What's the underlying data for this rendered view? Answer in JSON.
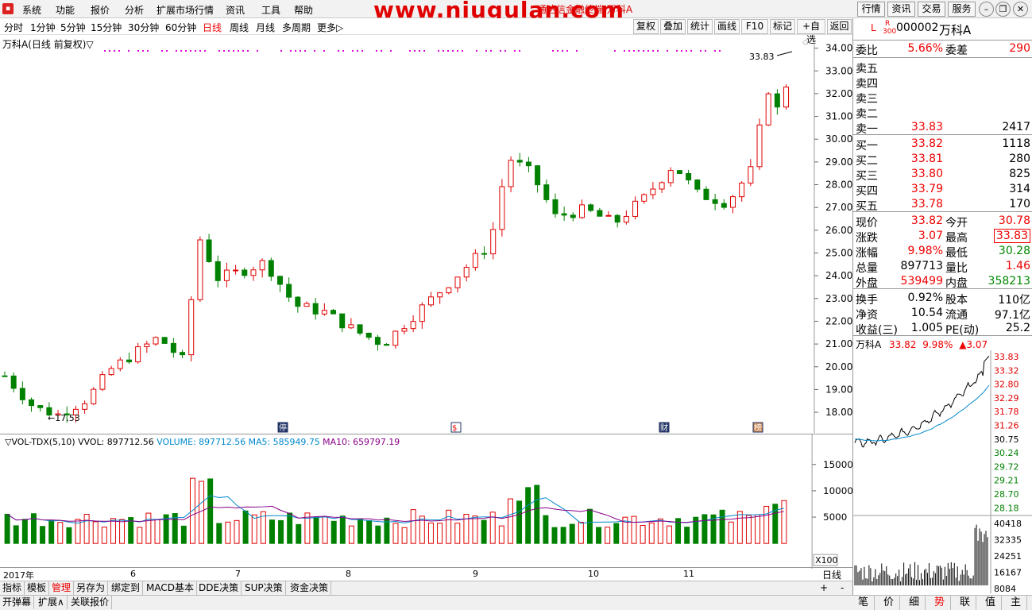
{
  "watermark": "www.niugulan.com",
  "app_title": "通达信金融终端 万科A",
  "menu": [
    "系统",
    "功能",
    "报价",
    "分析",
    "扩展市场行情",
    "资讯",
    "工具",
    "帮助"
  ],
  "top_buttons": [
    "行情",
    "资讯",
    "交易",
    "服务"
  ],
  "periods": [
    "分时",
    "1分钟",
    "5分钟",
    "15分钟",
    "30分钟",
    "60分钟",
    "日线",
    "周线",
    "月线",
    "多周期",
    "更多▷"
  ],
  "active_period": "日线",
  "toolbar_right": [
    "复权",
    "叠加",
    "统计",
    "画线",
    "F10",
    "标记",
    "+自选",
    "返回"
  ],
  "stock_label": "万科A(日线 前复权)▽",
  "price_axis": [
    "34.00",
    "33.00",
    "32.00",
    "31.00",
    "30.00",
    "29.00",
    "28.00",
    "27.00",
    "26.00",
    "25.00",
    "24.00",
    "23.00",
    "22.00",
    "21.00",
    "20.00",
    "19.00",
    "18.00"
  ],
  "high_marker": "33.83",
  "low_marker": "←17.53",
  "event_markers": [
    "停",
    "$",
    "财",
    "榜"
  ],
  "vol_indicator": {
    "name": "▽VOL-TDX(5,10)",
    "vvol": "VVOL: 897712.56",
    "volume": "VOLUME: 897712.56",
    "ma5": "MA5: 585949.75",
    "ma10": "MA10: 659797.19"
  },
  "vol_axis": [
    "15000",
    "10000",
    "5000"
  ],
  "vol_unit": "X100",
  "time_axis": [
    "2017年",
    "6",
    "7",
    "8",
    "9",
    "10",
    "11"
  ],
  "time_axis_right": "日线",
  "bottom_tabs1": [
    "指标",
    "模板",
    "管理",
    "另存为",
    "绑定到",
    "MACD基本",
    "DDE决策",
    "SUP决策",
    "资金决策"
  ],
  "bottom_tabs1_active": "管理",
  "bottom_tabs2": [
    "开弹幕",
    "扩展∧",
    "关联报价"
  ],
  "quote": {
    "code": "000002",
    "name": "万科A",
    "badge_l": "L",
    "badge_r": "R",
    "badge_300": "300",
    "weibi_label": "委比",
    "weibi": "5.66%",
    "weicha_label": "委差",
    "weicha": "290",
    "asks": [
      {
        "label": "卖五",
        "price": "",
        "vol": ""
      },
      {
        "label": "卖四",
        "price": "",
        "vol": ""
      },
      {
        "label": "卖三",
        "price": "",
        "vol": ""
      },
      {
        "label": "卖二",
        "price": "",
        "vol": ""
      },
      {
        "label": "卖一",
        "price": "33.83",
        "vol": "2417"
      }
    ],
    "bids": [
      {
        "label": "买一",
        "price": "33.82",
        "vol": "1118"
      },
      {
        "label": "买二",
        "price": "33.81",
        "vol": "280"
      },
      {
        "label": "买三",
        "price": "33.80",
        "vol": "825"
      },
      {
        "label": "买四",
        "price": "33.79",
        "vol": "314"
      },
      {
        "label": "买五",
        "price": "33.78",
        "vol": "170"
      }
    ],
    "stats1": [
      {
        "l1": "现价",
        "v1": "33.82",
        "c1": "red",
        "l2": "今开",
        "v2": "30.78",
        "c2": "red"
      },
      {
        "l1": "涨跌",
        "v1": "3.07",
        "c1": "red",
        "l2": "最高",
        "v2": "33.83",
        "c2": "red"
      },
      {
        "l1": "涨幅",
        "v1": "9.98%",
        "c1": "red",
        "l2": "最低",
        "v2": "30.28",
        "c2": "green"
      },
      {
        "l1": "总量",
        "v1": "897713",
        "c1": "",
        "l2": "量比",
        "v2": "1.46",
        "c2": "red"
      },
      {
        "l1": "外盘",
        "v1": "539499",
        "c1": "red",
        "l2": "内盘",
        "v2": "358213",
        "c2": "green"
      }
    ],
    "stats2": [
      {
        "l1": "换手",
        "v1": "0.92%",
        "l2": "股本",
        "v2": "110亿"
      },
      {
        "l1": "净资",
        "v1": "10.54",
        "l2": "流通",
        "v2": "97.1亿"
      },
      {
        "l1": "收益(三)",
        "v1": "1.005",
        "l2": "PE(动)",
        "v2": "25.2"
      }
    ],
    "mini_title": "万科A",
    "mini_price": "33.82",
    "mini_pct": "9.98%",
    "mini_chg": "▲3.07",
    "mini_price_axis": [
      "33.83",
      "33.32",
      "32.80",
      "32.29",
      "31.78",
      "31.26",
      "30.75",
      "30.24",
      "29.72",
      "29.21",
      "28.70",
      "28.18"
    ],
    "mini_vol_axis": [
      "40418",
      "32335",
      "24251",
      "16167",
      "8084"
    ],
    "tabs": [
      "笔",
      "价",
      "细",
      "势",
      "联",
      "值",
      "主"
    ],
    "tab_active": "势"
  },
  "colors": {
    "up": "#e00000",
    "down": "#008000",
    "ma5": "#0088cc",
    "ma10": "#880088",
    "magenta": "#dd00dd"
  }
}
